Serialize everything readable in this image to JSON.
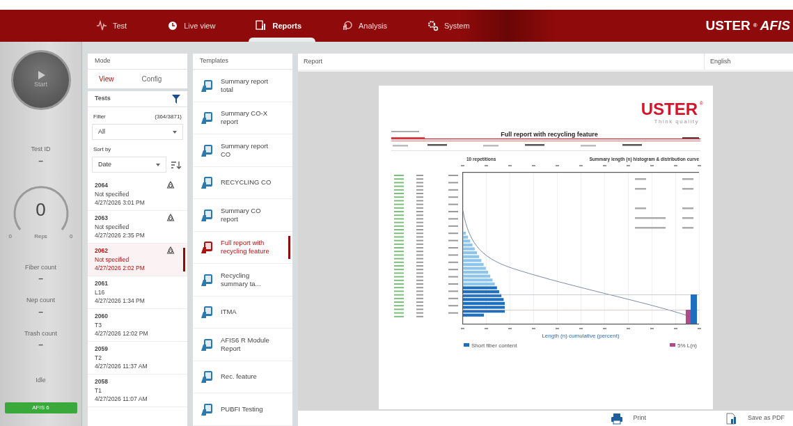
{
  "header": {
    "tabs": [
      {
        "label": "Test",
        "selected": false
      },
      {
        "label": "Live view",
        "selected": false
      },
      {
        "label": "Reports",
        "selected": true
      },
      {
        "label": "Analysis",
        "selected": false
      },
      {
        "label": "System",
        "selected": false
      }
    ],
    "brand": {
      "name": "USTER",
      "mark": "®",
      "product": "AFIS"
    }
  },
  "sidebar": {
    "start_label": "Start",
    "stats_top": [
      {
        "label": "Test ID",
        "value": "–"
      }
    ],
    "gauge": {
      "value": "0",
      "label": "Reps",
      "min": "0",
      "max": "0"
    },
    "stats": [
      {
        "label": "Fiber count",
        "value": "–"
      },
      {
        "label": "Nep count",
        "value": "–"
      },
      {
        "label": "Trash count",
        "value": "–"
      }
    ],
    "state": "Idle",
    "badges": [
      "AFIS 6"
    ]
  },
  "mode": {
    "title": "Mode",
    "tabs": [
      {
        "label": "View",
        "selected": true
      },
      {
        "label": "Config",
        "selected": false
      }
    ],
    "tests": {
      "title": "Tests",
      "filter_label": "Filter",
      "filter_count": "(364/3871)",
      "filter_value": "All",
      "sort_label": "Sort by",
      "sort_value": "Date",
      "items": [
        {
          "id": "2064",
          "name": "Not specified",
          "date": "4/27/2026 3:01 PM",
          "recycled": true,
          "selected": false
        },
        {
          "id": "2063",
          "name": "Not specified",
          "date": "4/27/2026 2:35 PM",
          "recycled": true,
          "selected": false
        },
        {
          "id": "2062",
          "name": "Not specified",
          "date": "4/27/2026 2:02 PM",
          "recycled": true,
          "selected": true
        },
        {
          "id": "2061",
          "name": "L16",
          "date": "4/27/2026 1:34 PM",
          "recycled": false,
          "selected": false
        },
        {
          "id": "2060",
          "name": "T3",
          "date": "4/27/2026 12:02 PM",
          "recycled": false,
          "selected": false
        },
        {
          "id": "2059",
          "name": "T2",
          "date": "4/27/2026 11:37 AM",
          "recycled": false,
          "selected": false
        },
        {
          "id": "2058",
          "name": "T1",
          "date": "4/27/2026 11:07 AM",
          "recycled": false,
          "selected": false
        }
      ]
    }
  },
  "templates": {
    "title": "Templates",
    "items": [
      {
        "label": "Summary report total",
        "selected": false
      },
      {
        "label": "Summary CO-X report",
        "selected": false
      },
      {
        "label": "Summary report CO",
        "selected": false
      },
      {
        "label": "RECYCLING CO",
        "selected": false
      },
      {
        "label": "Summary CO report",
        "selected": false
      },
      {
        "label": "Full report with recycling feature",
        "selected": true
      },
      {
        "label": "Recycling summary ta...",
        "selected": false
      },
      {
        "label": "ITMA",
        "selected": false
      },
      {
        "label": "AFIS6 R Module Report",
        "selected": false
      },
      {
        "label": "Rec. feature",
        "selected": false
      },
      {
        "label": "PUBFI Testing",
        "selected": false
      }
    ]
  },
  "report": {
    "title": "Report",
    "language": "English",
    "document": {
      "logo": "USTER",
      "logo_mark": "®",
      "tagline": "Think quality",
      "title": "Full report with recycling feature",
      "chart_title_left": "10 repetitions",
      "chart_title_right": "Summary length (n) histogram & distribution curve",
      "xlabel": "Length (n) cumulative (percent)",
      "legend": [
        {
          "label": "Short fiber content",
          "color": "#1f6fc0"
        },
        {
          "label": "5% L(n)",
          "color": "#b04a8a"
        }
      ]
    },
    "actions": [
      {
        "label": "Print"
      },
      {
        "label": "Save as PDF"
      }
    ]
  }
}
